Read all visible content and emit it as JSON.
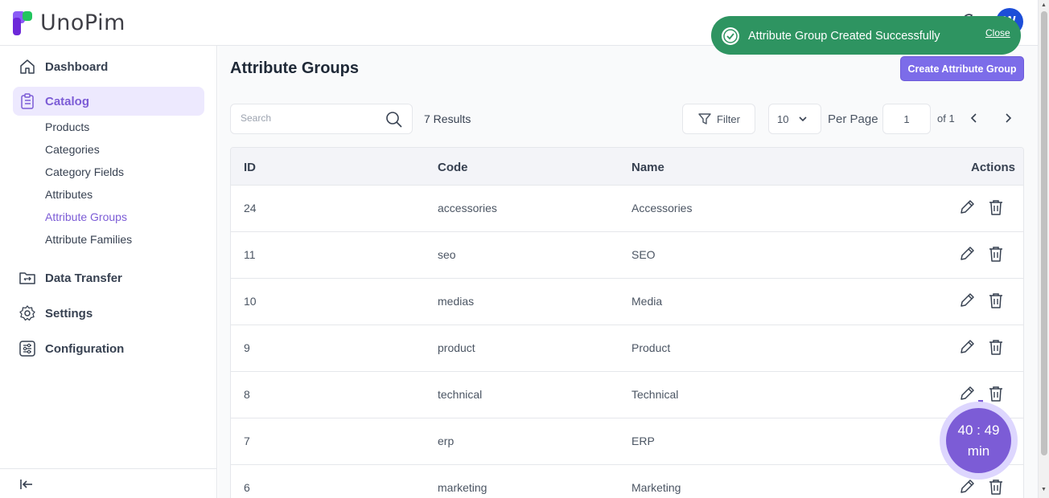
{
  "app": {
    "logo_text": "UnoPim",
    "avatar_initials": "W"
  },
  "sidebar": {
    "items": [
      {
        "label": "Dashboard",
        "icon": "home-icon"
      },
      {
        "label": "Catalog",
        "icon": "clipboard-icon",
        "active": true
      },
      {
        "label": "Data Transfer",
        "icon": "folder-transfer-icon"
      },
      {
        "label": "Settings",
        "icon": "gear-icon"
      },
      {
        "label": "Configuration",
        "icon": "sliders-icon"
      }
    ],
    "catalog_sub": [
      "Products",
      "Categories",
      "Category Fields",
      "Attributes",
      "Attribute Groups",
      "Attribute Families"
    ],
    "active_sub": "Attribute Groups"
  },
  "main": {
    "title": "Attribute Groups",
    "create_button": "Create Attribute Group",
    "search_placeholder": "Search",
    "results_label": "7 Results",
    "filter_label": "Filter",
    "per_page_value": "10",
    "per_page_label": "Per Page",
    "page_value": "1",
    "page_of": "of 1"
  },
  "table": {
    "headers": {
      "id": "ID",
      "code": "Code",
      "name": "Name",
      "actions": "Actions"
    },
    "rows": [
      {
        "id": "24",
        "code": "accessories",
        "name": "Accessories"
      },
      {
        "id": "11",
        "code": "seo",
        "name": "SEO"
      },
      {
        "id": "10",
        "code": "medias",
        "name": "Media"
      },
      {
        "id": "9",
        "code": "product",
        "name": "Product"
      },
      {
        "id": "8",
        "code": "technical",
        "name": "Technical"
      },
      {
        "id": "7",
        "code": "erp",
        "name": "ERP"
      },
      {
        "id": "6",
        "code": "marketing",
        "name": "Marketing"
      }
    ]
  },
  "toast": {
    "message": "Attribute Group Created Successfully",
    "close_label": "Close"
  },
  "timer": {
    "time": "40 : 49",
    "unit": "min"
  },
  "colors": {
    "accent": "#7c5cd6",
    "button": "#7c6ce9",
    "toast": "#2e9461"
  }
}
